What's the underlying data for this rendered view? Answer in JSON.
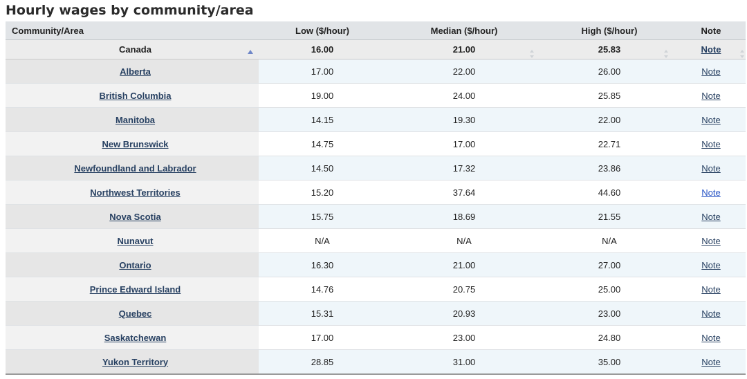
{
  "title": "Hourly wages by community/area",
  "headers": {
    "area": "Community/Area",
    "low": "Low ($/hour)",
    "median": "Median ($/hour)",
    "high": "High ($/hour)",
    "note": "Note"
  },
  "summary": {
    "area": "Canada",
    "low": "16.00",
    "median": "21.00",
    "high": "25.83",
    "note": "Note"
  },
  "rows": [
    {
      "area": "Alberta",
      "low": "17.00",
      "median": "22.00",
      "high": "26.00",
      "note": "Note"
    },
    {
      "area": "British Columbia",
      "low": "19.00",
      "median": "24.00",
      "high": "25.85",
      "note": "Note"
    },
    {
      "area": "Manitoba",
      "low": "14.15",
      "median": "19.30",
      "high": "22.00",
      "note": "Note"
    },
    {
      "area": "New Brunswick",
      "low": "14.75",
      "median": "17.00",
      "high": "22.71",
      "note": "Note"
    },
    {
      "area": "Newfoundland and Labrador",
      "low": "14.50",
      "median": "17.32",
      "high": "23.86",
      "note": "Note"
    },
    {
      "area": "Northwest Territories",
      "low": "15.20",
      "median": "37.64",
      "high": "44.60",
      "note": "Note"
    },
    {
      "area": "Nova Scotia",
      "low": "15.75",
      "median": "18.69",
      "high": "21.55",
      "note": "Note"
    },
    {
      "area": "Nunavut",
      "low": "N/A",
      "median": "N/A",
      "high": "N/A",
      "note": "Note"
    },
    {
      "area": "Ontario",
      "low": "16.30",
      "median": "21.00",
      "high": "27.00",
      "note": "Note"
    },
    {
      "area": "Prince Edward Island",
      "low": "14.76",
      "median": "20.75",
      "high": "25.00",
      "note": "Note"
    },
    {
      "area": "Quebec",
      "low": "15.31",
      "median": "20.93",
      "high": "23.00",
      "note": "Note"
    },
    {
      "area": "Saskatchewan",
      "low": "17.00",
      "median": "23.00",
      "high": "24.80",
      "note": "Note"
    },
    {
      "area": "Yukon Territory",
      "low": "28.85",
      "median": "31.00",
      "high": "35.00",
      "note": "Note"
    }
  ],
  "colors": {
    "link": "#284162",
    "visited_link": "#2a56c6",
    "header_bg": "#e1e4e7",
    "stripe_bg": "#eff6fa",
    "sort_active": "#6f87c8"
  }
}
